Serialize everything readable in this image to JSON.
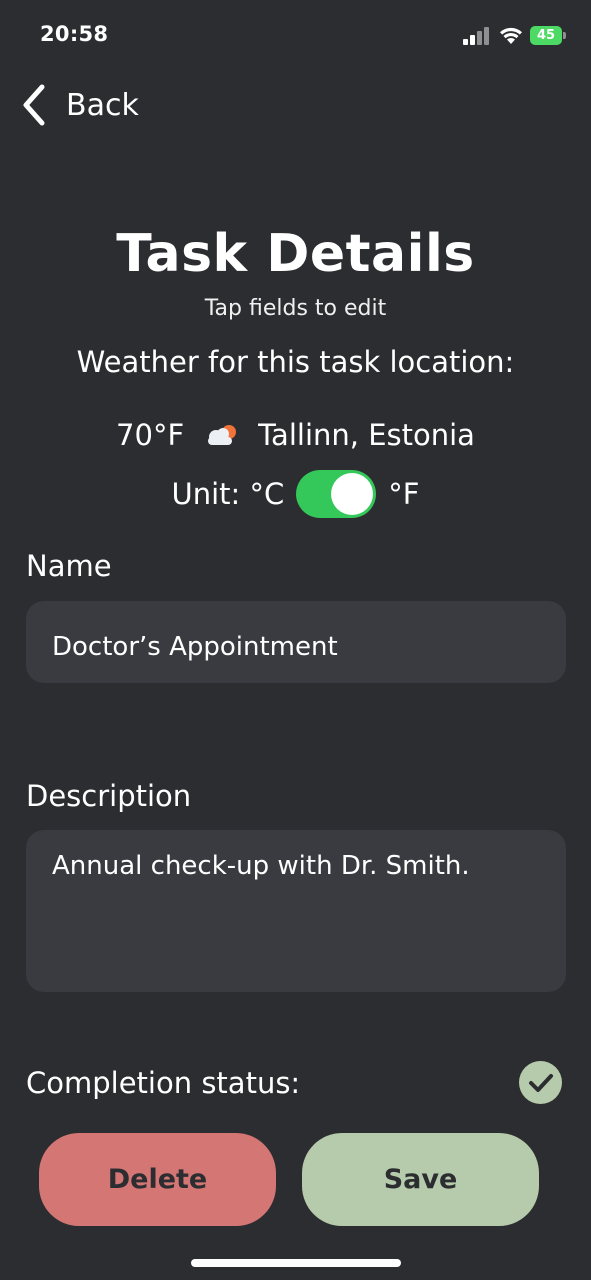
{
  "status_bar": {
    "time": "20:58",
    "battery": "45"
  },
  "nav": {
    "back_label": "Back"
  },
  "header": {
    "title": "Task Details",
    "subtitle": "Tap fields to edit"
  },
  "weather": {
    "heading": "Weather for this task location:",
    "temperature": "70°F",
    "icon": "partly-cloudy-icon",
    "location": "Tallinn, Estonia",
    "unit_prefix": "Unit: °C",
    "unit_suffix": "°F",
    "unit_toggle_on": true
  },
  "form": {
    "name_label": "Name",
    "name_value": "Doctor’s Appointment",
    "description_label": "Description",
    "description_value": "Annual check-up with Dr. Smith.",
    "completion_label": "Completion status:",
    "completed": true
  },
  "actions": {
    "delete_label": "Delete",
    "save_label": "Save"
  },
  "colors": {
    "background": "#2c2d31",
    "field": "#3a3b40",
    "toggle_on": "#34c759",
    "delete": "#d47674",
    "save": "#b6cbab"
  }
}
